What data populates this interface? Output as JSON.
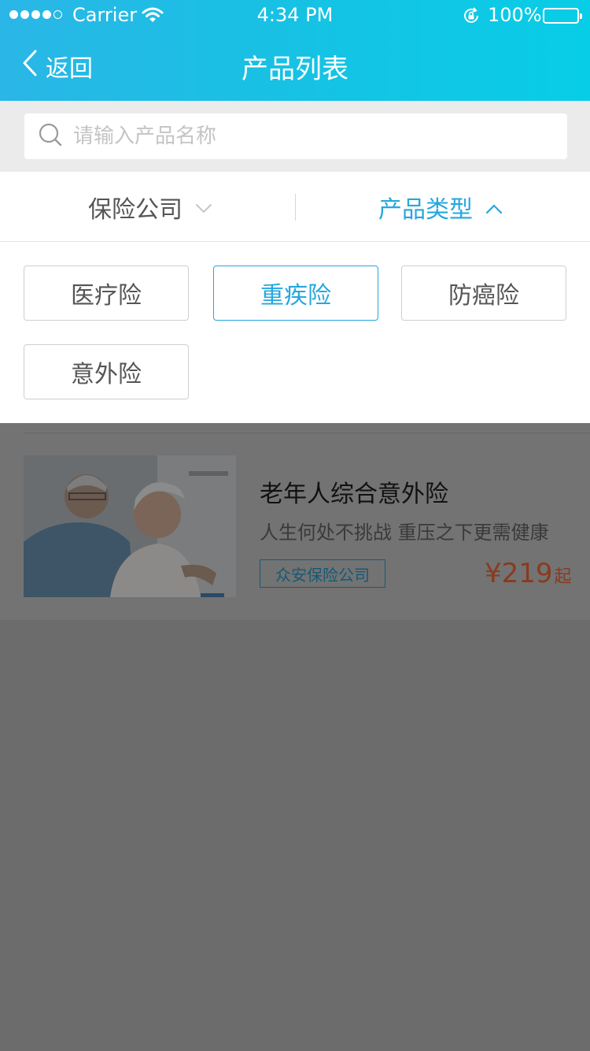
{
  "status_bar": {
    "carrier": "Carrier",
    "time": "4:34 PM",
    "battery": "100%"
  },
  "nav": {
    "back_label": "返回",
    "title": "产品列表"
  },
  "search": {
    "placeholder": "请输入产品名称",
    "value": ""
  },
  "filters": {
    "company_label": "保险公司",
    "type_label": "产品类型",
    "active": "产品类型"
  },
  "type_options": [
    "医疗险",
    "重疾险",
    "防癌险",
    "意外险"
  ],
  "selected_type": "重疾险",
  "products": [
    {
      "name": "老年人综合意外险",
      "description": "人生何处不挑战 重压之下更需健康",
      "company": "众安保险公司",
      "price": "¥219",
      "price_suffix": "起"
    }
  ],
  "colors": {
    "accent": "#25a7df",
    "header_gradient_start": "#2ab6e6",
    "header_gradient_end": "#08cde6",
    "price": "#e0521d",
    "overlay": "#6c6c6c"
  },
  "icons": [
    "chevron-left-icon",
    "search-icon",
    "chevron-down-icon",
    "chevron-up-icon",
    "wifi-icon",
    "rotation-lock-icon",
    "battery-icon"
  ]
}
